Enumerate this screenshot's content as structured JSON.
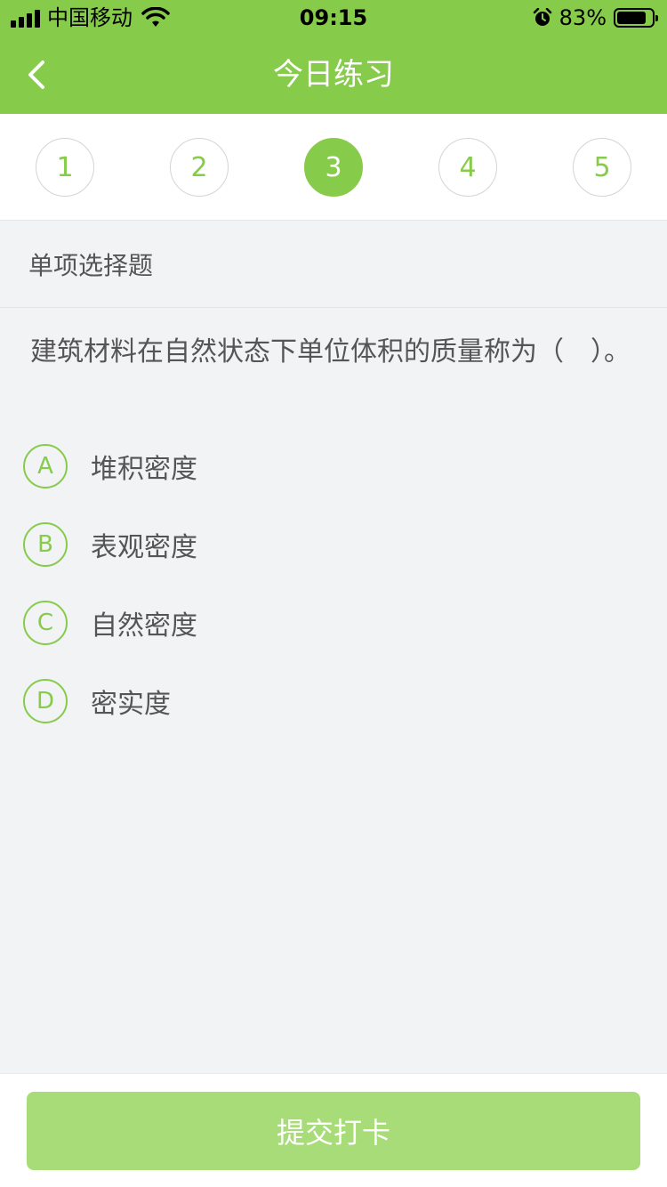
{
  "status_bar": {
    "carrier": "中国移动",
    "time": "09:15",
    "battery_percent": "83%",
    "battery_level": 0.83,
    "icons": [
      "signal-icon",
      "wifi-icon",
      "alarm-icon",
      "battery-icon"
    ]
  },
  "nav": {
    "back_icon": "chevron-left-icon",
    "title": "今日练习"
  },
  "steps": [
    {
      "label": "1",
      "active": false
    },
    {
      "label": "2",
      "active": false
    },
    {
      "label": "3",
      "active": true
    },
    {
      "label": "4",
      "active": false
    },
    {
      "label": "5",
      "active": false
    }
  ],
  "question": {
    "type": "单项选择题",
    "text": "建筑材料在自然状态下单位体积的质量称为（　）。",
    "options": [
      {
        "letter": "A",
        "text": "堆积密度"
      },
      {
        "letter": "B",
        "text": "表观密度"
      },
      {
        "letter": "C",
        "text": "自然密度"
      },
      {
        "letter": "D",
        "text": "密实度"
      }
    ]
  },
  "footer": {
    "submit_label": "提交打卡"
  },
  "colors": {
    "accent": "#87cb4b",
    "button_disabled": "#a8dc78",
    "background": "#f2f3f5"
  }
}
